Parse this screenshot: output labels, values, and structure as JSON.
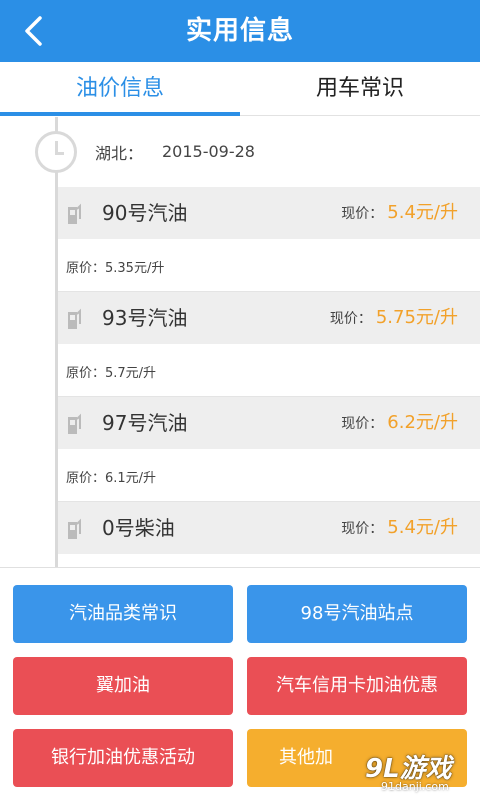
{
  "header": {
    "title": "实用信息",
    "back_icon": "chevron-left-icon"
  },
  "tabs": [
    {
      "label": "油价信息",
      "active": true
    },
    {
      "label": "用车常识",
      "active": false
    }
  ],
  "oil": {
    "region": "湖北：",
    "date": "2015-09-28",
    "items": [
      {
        "name": "90号汽油",
        "price_label": "现价：",
        "price": "5.4元/升",
        "original": "原价：5.35元/升"
      },
      {
        "name": "93号汽油",
        "price_label": "现价：",
        "price": "5.75元/升",
        "original": "原价：5.7元/升"
      },
      {
        "name": "97号汽油",
        "price_label": "现价：",
        "price": "6.2元/升",
        "original": "原价：6.1元/升"
      },
      {
        "name": "0号柴油",
        "price_label": "现价：",
        "price": "5.4元/升"
      }
    ]
  },
  "buttons": [
    {
      "label": "汽油品类常识",
      "color": "#3a95ea"
    },
    {
      "label": "98号汽油站点",
      "color": "#3a95ea"
    },
    {
      "label": "翼加油",
      "color": "#ea4f55"
    },
    {
      "label": "汽车信用卡加油优惠",
      "color": "#ea4f55"
    },
    {
      "label": "银行加油优惠活动",
      "color": "#ea4f55"
    },
    {
      "label": "其他加",
      "color": "#f5ae2e"
    }
  ],
  "watermark": {
    "logo": "9L游戏",
    "sub": "91danji.com"
  },
  "colors": {
    "accent": "#2b8fe6",
    "price": "#f2a12a",
    "red": "#ea4f55",
    "orange": "#f5ae2e"
  }
}
